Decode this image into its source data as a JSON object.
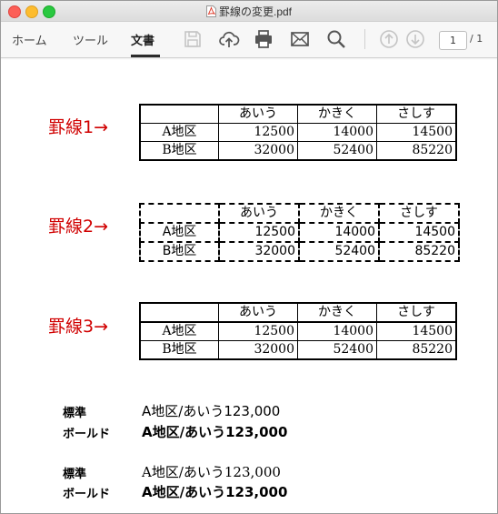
{
  "window": {
    "title": "罫線の変更.pdf"
  },
  "toolbar": {
    "tabs": [
      {
        "label": "ホーム"
      },
      {
        "label": "ツール"
      },
      {
        "label": "文書"
      }
    ],
    "icons": [
      "save-icon",
      "upload-cloud-icon",
      "print-icon",
      "mail-icon",
      "search-icon",
      "arrow-up-icon",
      "arrow-down-icon"
    ],
    "page_current": "1",
    "page_total": "/ 1"
  },
  "doc": {
    "labels": [
      "罫線1→",
      "罫線2→",
      "罫線3→"
    ],
    "table": {
      "headers": [
        "",
        "あいう",
        "かきく",
        "さしす"
      ],
      "rows": [
        [
          "A地区",
          "12500",
          "14000",
          "14500"
        ],
        [
          "B地区",
          "32000",
          "52400",
          "85220"
        ]
      ]
    },
    "fonts": [
      {
        "label": "標準",
        "sample": "A地区/あいう123,000"
      },
      {
        "label": "ボールド",
        "sample": "A地区/あいう123,000"
      },
      {
        "label": "標準",
        "sample": "A地区/あいう123,000"
      },
      {
        "label": "ボールド",
        "sample": "A地区/あいう123,000"
      }
    ]
  },
  "colors": {
    "label_red": "#d00000",
    "accent_dark": "#2b2b2b"
  }
}
